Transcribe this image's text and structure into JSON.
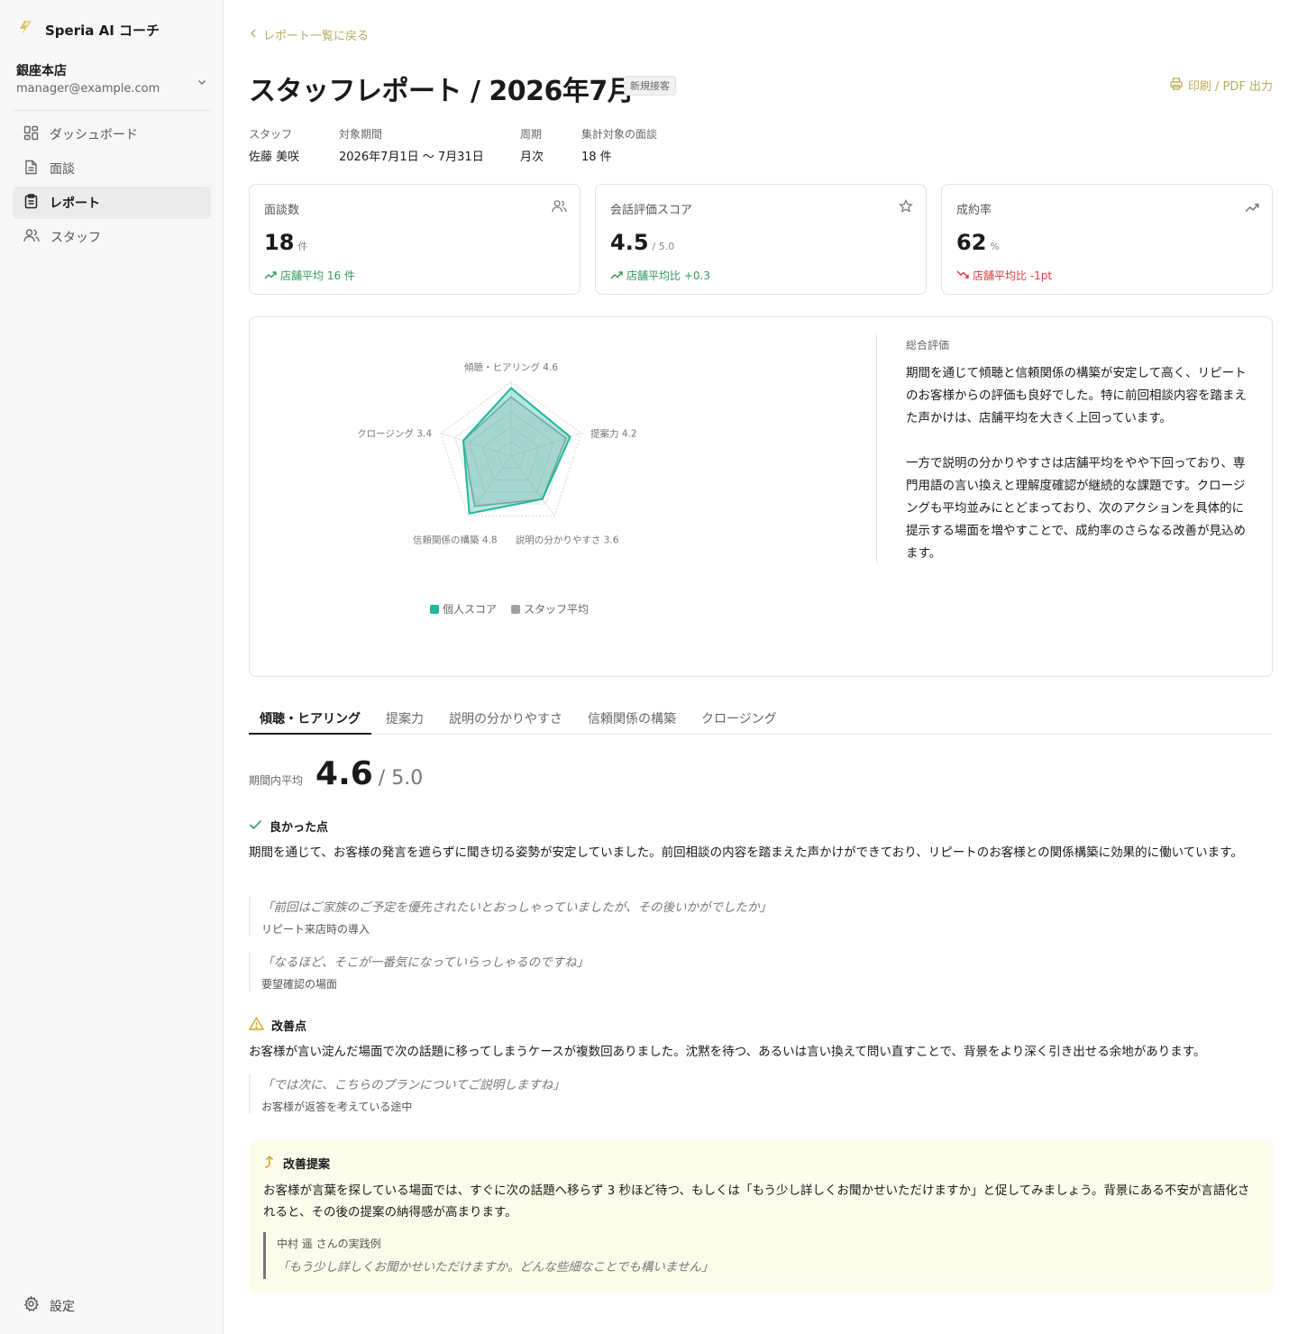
{
  "app": {
    "name": "Speria AI コーチ"
  },
  "store": {
    "name": "銀座本店",
    "email": "manager@example.com"
  },
  "nav": [
    {
      "label": "ダッシュボード",
      "icon": "dashboard-icon"
    },
    {
      "label": "面談",
      "icon": "document-icon"
    },
    {
      "label": "レポート",
      "icon": "clipboard-icon",
      "active": true
    },
    {
      "label": "スタッフ",
      "icon": "users-icon"
    }
  ],
  "settings": {
    "label": "設定"
  },
  "back": {
    "label": "レポート一覧に戻る"
  },
  "header": {
    "title": "スタッフレポート / 2026年7月",
    "badge": "新規接客",
    "print_label": "印刷 / PDF 出力"
  },
  "meta": [
    {
      "label": "スタッフ",
      "value": "佐藤 美咲"
    },
    {
      "label": "対象期間",
      "value": "2026年7月1日 〜 7月31日"
    },
    {
      "label": "周期",
      "value": "月次"
    },
    {
      "label": "集計対象の面談",
      "value": "18 件"
    }
  ],
  "kpis": [
    {
      "label": "面談数",
      "value": "18",
      "unit": "件",
      "trend": "店舗平均 16 件",
      "direction": "up",
      "icon": "users-icon"
    },
    {
      "label": "会話評価スコア",
      "value": "4.5",
      "unit": "/ 5.0",
      "trend": "店舗平均比 +0.3",
      "direction": "up",
      "icon": "star-icon"
    },
    {
      "label": "成約率",
      "value": "62",
      "unit": "%",
      "trend": "店舗平均比 -1pt",
      "direction": "down",
      "icon": "trending-up-icon"
    }
  ],
  "chart_data": {
    "type": "radar",
    "categories": [
      "傾聴・ヒアリング",
      "提案力",
      "説明の分かりやすさ",
      "信頼関係の構築",
      "クロージング"
    ],
    "category_labels": [
      "傾聴・ヒアリング 4.6",
      "提案力 4.2",
      "説明の分かりやすさ 3.6",
      "信頼関係の構築 4.8",
      "クロージング 3.4"
    ],
    "max": 5,
    "series": [
      {
        "name": "個人スコア",
        "values": [
          4.6,
          4.2,
          3.6,
          4.8,
          3.4
        ],
        "color": "#1fb89a"
      },
      {
        "name": "スタッフ平均",
        "values": [
          4.0,
          3.9,
          3.6,
          4.2,
          3.4
        ],
        "color": "#9ca3a8"
      }
    ],
    "legend": "bottom"
  },
  "overall": {
    "label": "総合評価",
    "text": "期間を通じて傾聴と信頼関係の構築が安定して高く、リピートのお客様からの評価も良好でした。特に前回相談内容を踏まえた声かけは、店舗平均を大きく上回っています。\n\n一方で説明の分かりやすさは店舗平均をやや下回っており、専門用語の言い換えと理解度確認が継続的な課題です。クロージングも平均並みにとどまっており、次のアクションを具体的に提示する場面を増やすことで、成約率のさらなる改善が見込めます。"
  },
  "tabs": [
    "傾聴・ヒアリング",
    "提案力",
    "説明の分かりやすさ",
    "信頼関係の構築",
    "クロージング"
  ],
  "detail": {
    "avg_label": "期間内平均",
    "avg_value": "4.6",
    "avg_of": "/ 5.0",
    "good_title": "良かった点",
    "good_text": "期間を通じて、お客様の発言を遮らずに聞き切る姿勢が安定していました。前回相談の内容を踏まえた声かけができており、リピートのお客様との関係構築に効果的に働いています。",
    "good_quotes": [
      {
        "text": "「前回はご家族のご予定を優先されたいとおっしゃっていましたが、その後いかがでしたか」",
        "context": "リピート来店時の導入"
      },
      {
        "text": "「なるほど、そこが一番気になっていらっしゃるのですね」",
        "context": "要望確認の場面"
      }
    ],
    "improve_title": "改善点",
    "improve_text": "お客様が言い淀んだ場面で次の話題に移ってしまうケースが複数回ありました。沈黙を待つ、あるいは言い換えて問い直すことで、背景をより深く引き出せる余地があります。",
    "improve_quotes": [
      {
        "text": "「では次に、こちらのプランについてご説明しますね」",
        "context": "お客様が返答を考えている途中"
      }
    ],
    "suggest_title": "改善提案",
    "suggest_text": "お客様が言葉を探している場面では、すぐに次の話題へ移らず 3 秒ほど待つ、もしくは「もう少し詳しくお聞かせいただけますか」と促してみましょう。背景にある不安が言語化されると、その後の提案の納得感が高まります。",
    "example_name": "中村 遥 さんの実践例",
    "example_text": "「もう少し詳しくお聞かせいただけますか。どんな些細なことでも構いません」"
  },
  "colors": {
    "accent": "#b8ac5a",
    "teal": "#1fb89a",
    "up": "#2e9a5a",
    "down": "#d83b3b"
  }
}
